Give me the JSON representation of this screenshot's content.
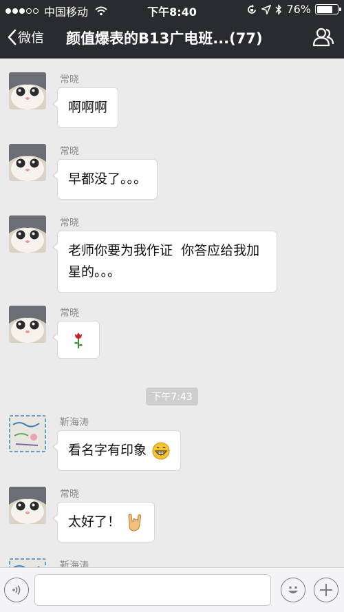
{
  "status_bar": {
    "carrier": "中国移动",
    "time": "下午8:40",
    "battery_percent": "76%",
    "battery_level": 0.76
  },
  "nav": {
    "back_label": "微信",
    "title": "颜值爆表的B13广电班...(77)"
  },
  "messages": [
    {
      "sender": "常晓",
      "text": "啊啊啊"
    },
    {
      "sender": "常晓",
      "text": "早都没了。。。"
    },
    {
      "sender": "常晓",
      "text": "老师你要为我作证  你答应给我加星的。。。"
    },
    {
      "sender": "常晓",
      "text": "",
      "emoji": "rose-icon"
    },
    {
      "sender": "靳海涛",
      "text": "看名字有印象",
      "emoji": "grin-face-icon"
    },
    {
      "sender": "常晓",
      "text": "太好了！",
      "emoji": "rock-hand-icon"
    },
    {
      "sender": "靳海涛",
      "text": ""
    }
  ],
  "timestamp": "下午7:43",
  "input": {
    "value": "",
    "placeholder": ""
  },
  "colors": {
    "header_bg": "#2a2b2f",
    "chat_bg": "#ebebeb",
    "bubble_bg": "#ffffff",
    "timestamp_bg": "#cecece"
  }
}
